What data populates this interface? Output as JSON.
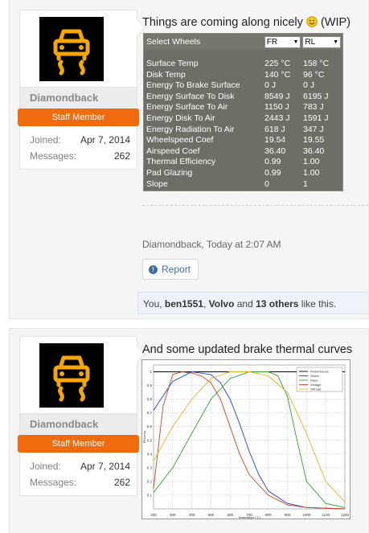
{
  "posts": [
    {
      "username": "Diamondback",
      "badge": "Staff Member",
      "joined_label": "Joined:",
      "joined_value": "Apr 7, 2014",
      "messages_label": "Messages:",
      "messages_value": "262",
      "title": "Things are coming along nicely",
      "title_suffix": "(WIP)",
      "author_line": "Diamondback, Today at 2:07 AM",
      "report_label": "Report",
      "likes": {
        "prefix": "You, ",
        "user1": "ben1551",
        "sep": ", ",
        "user2": "Volvo",
        "and": " and ",
        "others": "13 others",
        "suffix": " like this."
      },
      "wheel_panel": {
        "select_label": "Select Wheels",
        "select_a": "FR",
        "select_b": "RL",
        "rows": [
          {
            "name": "Surface Temp",
            "a": "225 °C",
            "b": "158 °C"
          },
          {
            "name": "Disk Temp",
            "a": "140 °C",
            "b": "96 °C"
          },
          {
            "name": "Energy To Brake Surface",
            "a": "0 J",
            "b": "0 J"
          },
          {
            "name": "Energy Surface To Disk",
            "a": "8549 J",
            "b": "6195 J"
          },
          {
            "name": "Energy Surface To Air",
            "a": "1150 J",
            "b": "783 J"
          },
          {
            "name": "Energy Disk To Air",
            "a": "2443 J",
            "b": "1591 J"
          },
          {
            "name": "Energy Radiation To Air",
            "a": "618 J",
            "b": "347 J"
          },
          {
            "name": "Wheelspeed Coef",
            "a": "19.54",
            "b": "19.55"
          },
          {
            "name": "Airspeed Coef",
            "a": "36.40",
            "b": "36.40"
          },
          {
            "name": "Thermal Efficiency",
            "a": "0.99",
            "b": "1.00"
          },
          {
            "name": "Pad Glazing",
            "a": "0.99",
            "b": "1.00"
          },
          {
            "name": "Slope",
            "a": "0",
            "b": "1"
          }
        ]
      }
    },
    {
      "username": "Diamondback",
      "badge": "Staff Member",
      "joined_label": "Joined:",
      "joined_value": "Apr 7, 2014",
      "messages_label": "Messages:",
      "messages_value": "262",
      "title": "And some updated brake thermal curves"
    }
  ],
  "chart_data": {
    "type": "line",
    "title": "",
    "xlabel": "Temperature (°C)",
    "ylabel": "Efficiency",
    "xlim": [
      200,
      1200
    ],
    "ylim": [
      0,
      1.05
    ],
    "x_ticks": [
      200,
      300,
      400,
      500,
      600,
      700,
      800,
      900,
      1000,
      1100,
      1200
    ],
    "y_ticks": [
      0.1,
      0.2,
      0.3,
      0.4,
      0.5,
      0.6,
      0.7,
      0.8,
      0.9,
      1
    ],
    "grid": true,
    "legend_position": "top-right",
    "series": [
      {
        "name": "Performance",
        "color": "#000000",
        "x": [
          200,
          400,
          600,
          800,
          900,
          1000,
          1100,
          1200
        ],
        "y": [
          1,
          1,
          1,
          1,
          1,
          1,
          1,
          1
        ]
      },
      {
        "name": "Street",
        "color": "#1f3fd0",
        "x": [
          200,
          300,
          400,
          500,
          550,
          600,
          650,
          700,
          750,
          800,
          900,
          1000,
          1200
        ],
        "y": [
          0.72,
          0.93,
          1.0,
          0.98,
          0.92,
          0.8,
          0.62,
          0.42,
          0.25,
          0.13,
          0.04,
          0.01,
          0.0
        ]
      },
      {
        "name": "Race",
        "color": "#2aa02a",
        "x": [
          200,
          300,
          400,
          500,
          600,
          700,
          800,
          850,
          900,
          950,
          1000,
          1100,
          1200
        ],
        "y": [
          0.12,
          0.3,
          0.55,
          0.8,
          0.95,
          1.0,
          1.0,
          0.97,
          0.82,
          0.5,
          0.2,
          0.04,
          0.01
        ]
      },
      {
        "name": "Vintage",
        "color": "#d04020",
        "x": [
          200,
          250,
          300,
          350,
          400,
          450,
          500,
          550,
          600,
          650,
          700,
          800,
          900,
          1000,
          1200
        ],
        "y": [
          0.15,
          0.75,
          0.98,
          1.0,
          0.99,
          0.97,
          0.92,
          0.8,
          0.6,
          0.4,
          0.25,
          0.1,
          0.03,
          0.01,
          0.0
        ]
      },
      {
        "name": "Offroad",
        "color": "#e8b020",
        "x": [
          200,
          300,
          400,
          500,
          600,
          700,
          800,
          900,
          1000,
          1100,
          1200
        ],
        "y": [
          0.35,
          0.6,
          0.8,
          0.95,
          1.0,
          1.0,
          0.97,
          0.85,
          0.55,
          0.2,
          0.05
        ]
      }
    ]
  },
  "colors": {
    "staff_badge": "#f06a0e",
    "link": "#3e6ea4",
    "icon_orange": "#f7a800"
  }
}
